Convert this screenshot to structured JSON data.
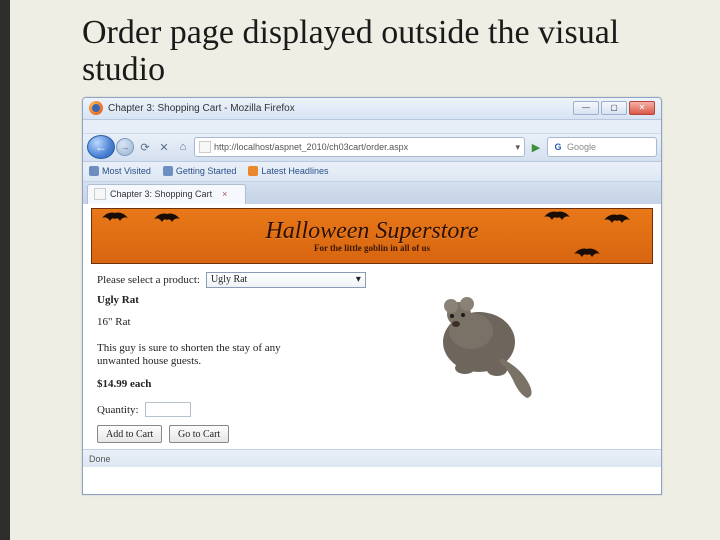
{
  "slide": {
    "title": "Order page displayed outside the visual studio"
  },
  "title_bar": {
    "text": "Chapter 3: Shopping Cart - Mozilla Firefox",
    "min": "—",
    "max": "▢",
    "close": "✕"
  },
  "nav": {
    "back_glyph": "←",
    "fwd_glyph": "→",
    "reload_glyph": "⟳",
    "stop_glyph": "✕",
    "home_glyph": "⌂",
    "url": "http://localhost/aspnet_2010/ch03cart/order.aspx",
    "url_dropdown_glyph": "▾",
    "go_glyph": "▶",
    "search_placeholder": "Google"
  },
  "bookmarks": {
    "most_visited": "Most Visited",
    "getting_started": "Getting Started",
    "latest_headlines": "Latest Headlines"
  },
  "tab": {
    "label": "Chapter 3: Shopping Cart",
    "close_glyph": "×"
  },
  "banner": {
    "title": "Halloween Superstore",
    "subtitle": "For the little goblin in all of us"
  },
  "form": {
    "select_label": "Please select a product:",
    "selected_option": "Ugly Rat",
    "dropdown_glyph": "▾",
    "product_name": "Ugly Rat",
    "product_size": "16\" Rat",
    "product_desc": "This guy is sure to shorten the stay of any unwanted house guests.",
    "product_price": "$14.99 each",
    "qty_label": "Quantity:",
    "add_button": "Add to Cart",
    "goto_button": "Go to Cart"
  },
  "status": {
    "text": "Done"
  }
}
